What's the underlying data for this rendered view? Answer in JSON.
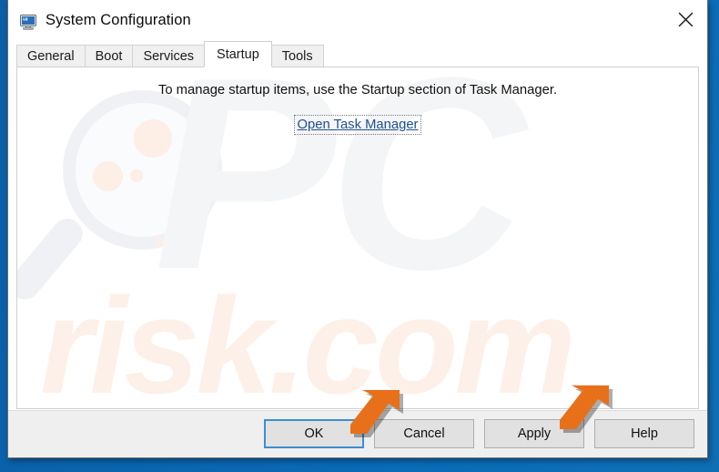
{
  "window": {
    "title": "System Configuration",
    "icon": "system-configuration-monitor-icon",
    "close_label": "✕"
  },
  "tabs": [
    {
      "label": "General",
      "active": false
    },
    {
      "label": "Boot",
      "active": false
    },
    {
      "label": "Services",
      "active": false
    },
    {
      "label": "Startup",
      "active": true
    },
    {
      "label": "Tools",
      "active": false
    }
  ],
  "content": {
    "message": "To manage startup items, use the Startup section of Task Manager.",
    "link_label": "Open Task Manager"
  },
  "footer": {
    "buttons": [
      {
        "label": "OK",
        "focused": true
      },
      {
        "label": "Cancel",
        "focused": false
      },
      {
        "label": "Apply",
        "focused": false
      },
      {
        "label": "Help",
        "focused": false
      }
    ]
  },
  "watermark": {
    "brand_text": "PC",
    "domain_text": "risk.com",
    "brand_color": "#f4f5f6",
    "domain_color": "#fdf0e8",
    "glass_color": "#f0f1f4"
  },
  "annotations": [
    {
      "name": "arrow-pointing-to-ok",
      "color": "#e8701a",
      "target": "OK"
    },
    {
      "name": "arrow-pointing-to-apply",
      "color": "#e8701a",
      "target": "Apply"
    }
  ],
  "colors": {
    "desktop": "#0b64ad",
    "accent_focus": "#3c8ed1",
    "link": "#1d4f91",
    "button_face": "#e1e1e1",
    "footer": "#efefef"
  }
}
